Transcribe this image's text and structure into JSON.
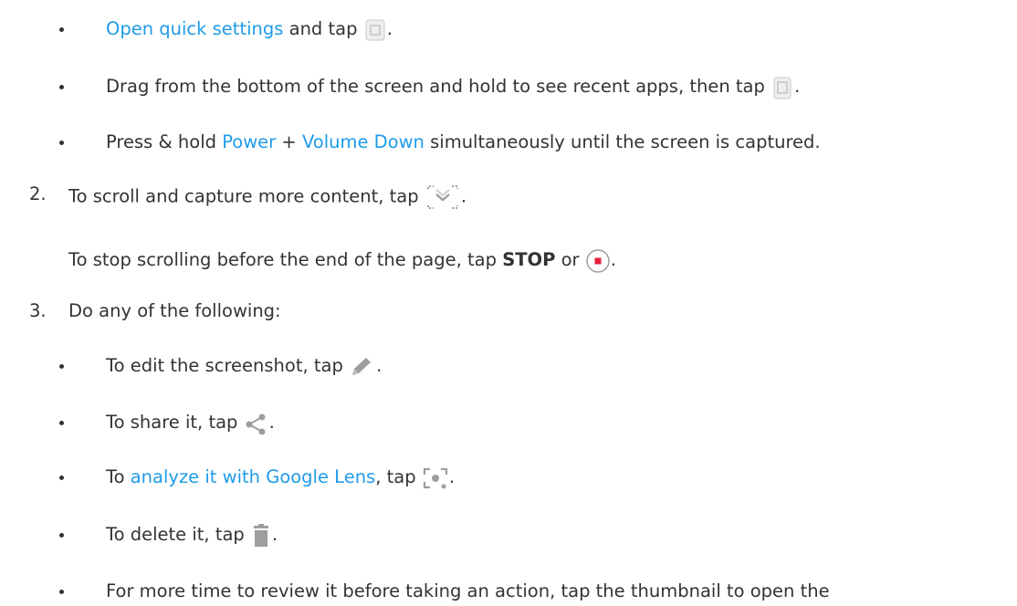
{
  "bullets_top": [
    {
      "link": "Open quick settings",
      "text": " and tap ",
      "end": "."
    },
    {
      "text": "Drag from the bottom of the screen and hold to see recent apps, then tap ",
      "end": "."
    },
    {
      "pre": "Press & hold ",
      "link1": "Power",
      "mid": " + ",
      "link2": "Volume Down",
      "post": " simultaneously until the screen is captured."
    }
  ],
  "steps": [
    {
      "number": "2.",
      "text": "To scroll and capture more content, tap ",
      "end": ".",
      "sub": {
        "pre": "To stop scrolling before the end of the page, tap ",
        "bold": "STOP",
        "mid": " or ",
        "end": "."
      }
    },
    {
      "number": "3.",
      "text": "Do any of the following:"
    }
  ],
  "actions": [
    {
      "text": "To edit the screenshot, tap ",
      "end": ".",
      "icon": "pencil-icon"
    },
    {
      "text": "To share it, tap ",
      "end": ".",
      "icon": "share-icon"
    },
    {
      "pre": "To ",
      "link": "analyze it with Google Lens",
      "text": ", tap ",
      "end": ".",
      "icon": "google-lens-icon"
    },
    {
      "text": "To delete it, tap ",
      "end": ".",
      "icon": "trash-icon"
    },
    {
      "text": "For more time to review it before taking an action, tap the thumbnail to open the"
    }
  ],
  "colors": {
    "link": "#1e9be8",
    "text": "#333333",
    "icon": "#9e9e9e",
    "stop_red": "#e5203a"
  }
}
